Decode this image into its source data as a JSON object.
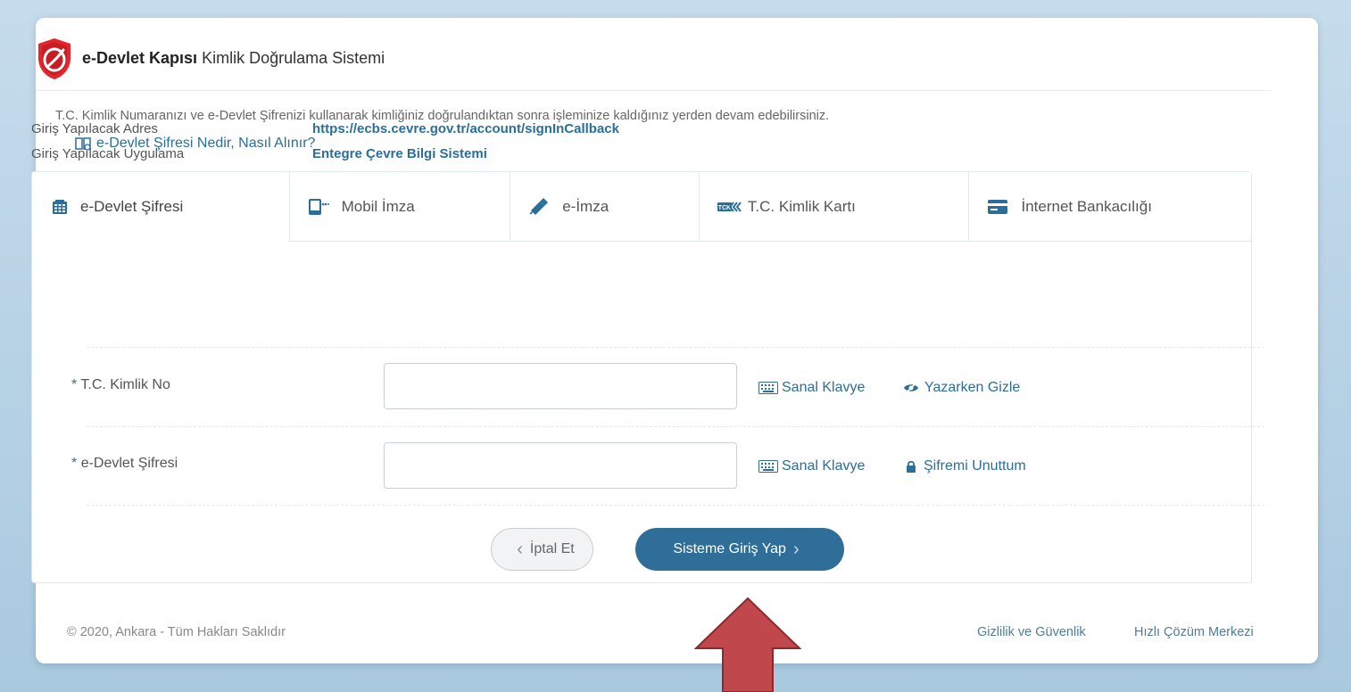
{
  "header": {
    "brand": "e-Devlet Kapısı",
    "subtitle": "Kimlik Doğrulama Sistemi"
  },
  "info": {
    "address_label": "Giriş Yapılacak Adres",
    "address_value": "https://ecbs.cevre.gov.tr/account/signInCallback",
    "app_label": "Giriş Yapılacak Uygulama",
    "app_value": "Entegre Çevre Bilgi Sistemi"
  },
  "tabs": [
    {
      "label": "e-Devlet Şifresi",
      "icon": "keypad-icon",
      "active": true
    },
    {
      "label": "Mobil İmza",
      "icon": "mobile-signature-icon",
      "active": false
    },
    {
      "label": "e-İmza",
      "icon": "usb-token-icon",
      "active": false
    },
    {
      "label": "T.C. Kimlik Kartı",
      "icon": "id-card-icon",
      "active": false
    },
    {
      "label": "İnternet Bankacılığı",
      "icon": "bank-card-icon",
      "active": false
    }
  ],
  "form": {
    "description": "T.C. Kimlik Numaranızı ve e-Devlet Şifrenizi kullanarak kimliğiniz doğrulandıktan sonra işleminize kaldığınız yerden devam edebilirsiniz.",
    "help_link": "e-Devlet Şifresi Nedir, Nasıl Alınır?",
    "fields": [
      {
        "required_mark": "*",
        "label": "T.C. Kimlik No",
        "value": "",
        "virtual_keyboard": "Sanal Klavye",
        "extra": "Yazarken Gizle"
      },
      {
        "required_mark": "*",
        "label": "e-Devlet Şifresi",
        "value": "",
        "virtual_keyboard": "Sanal Klavye",
        "extra": "Şifremi Unuttum"
      }
    ],
    "cancel_label": "İptal Et",
    "submit_label": "Sisteme Giriş Yap"
  },
  "footer": {
    "copyright": "© 2020, Ankara - Tüm Hakları Saklıdır",
    "links": [
      "Gizlilik ve Güvenlik",
      "Hızlı Çözüm Merkezi"
    ]
  },
  "colors": {
    "accent": "#2e6e98",
    "link": "#2b6e9a",
    "logo_red": "#e3262d",
    "annotation_arrow": "#c0484d"
  }
}
